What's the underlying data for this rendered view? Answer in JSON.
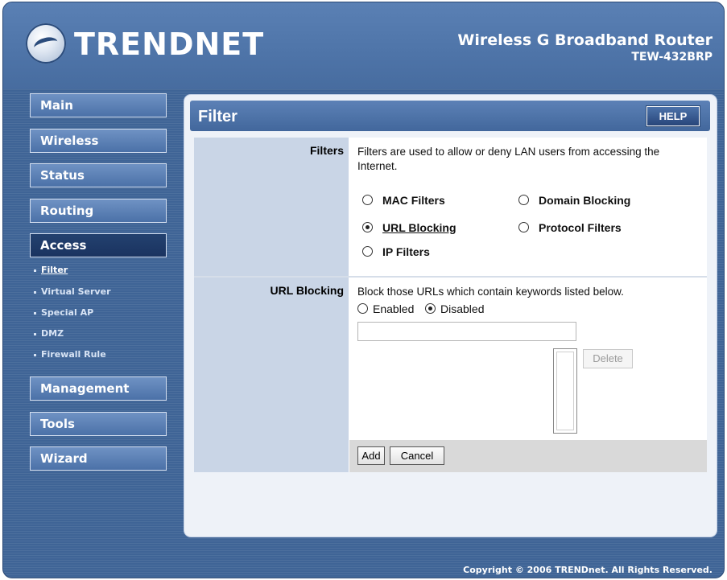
{
  "header": {
    "brand": "TRENDNET",
    "product_name": "Wireless G Broadband Router",
    "model": "TEW-432BRP"
  },
  "nav": {
    "main": "Main",
    "wireless": "Wireless",
    "status": "Status",
    "routing": "Routing",
    "access": "Access",
    "access_sub": [
      "Filter",
      "Virtual Server",
      "Special AP",
      "DMZ",
      "Firewall Rule"
    ],
    "management": "Management",
    "tools": "Tools",
    "wizard": "Wizard"
  },
  "page": {
    "title": "Filter",
    "help_label": "HELP"
  },
  "filters": {
    "label": "Filters",
    "description": "Filters are used to allow or deny LAN users from accessing the Internet.",
    "options": {
      "mac": "MAC Filters",
      "domain": "Domain Blocking",
      "url": "URL Blocking",
      "protocol": "Protocol Filters",
      "ip": "IP Filters"
    },
    "selected": "URL Blocking"
  },
  "url_blocking": {
    "label": "URL Blocking",
    "description": "Block those URLs which contain keywords listed below.",
    "enabled_label": "Enabled",
    "disabled_label": "Disabled",
    "state": "Disabled",
    "keyword_value": "",
    "delete_label": "Delete"
  },
  "actions": {
    "add_label": "Add",
    "cancel_label": "Cancel"
  },
  "footer": {
    "copyright": "Copyright © 2006 TRENDnet. All Rights Reserved."
  },
  "colors": {
    "frame": "#3f6496",
    "nav_active": "#1a3360",
    "title_bar": "#4e74a8",
    "label_column": "#c9d5e6"
  }
}
